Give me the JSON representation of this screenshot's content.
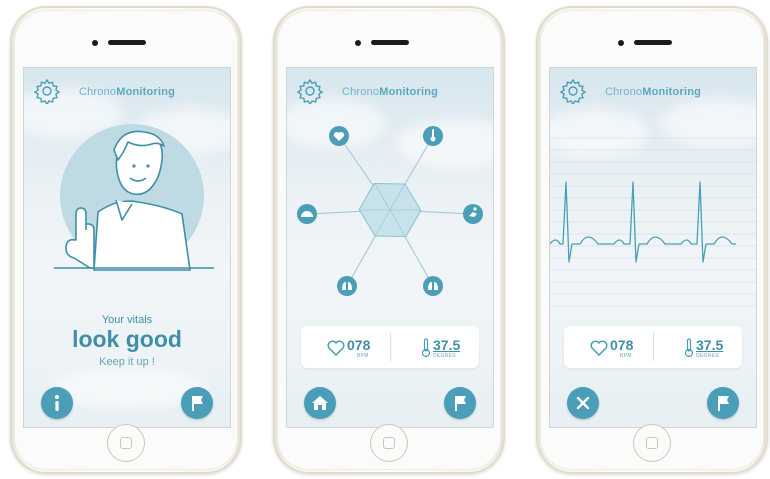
{
  "app": {
    "title_prefix": "Chrono",
    "title_suffix": "Monitoring"
  },
  "screens": [
    {
      "id": "status",
      "message_line1": "Your vitals",
      "message_line2": "look good",
      "message_line3": "Keep it up !",
      "left_button_icon": "info-icon",
      "right_button_icon": "flag-icon"
    },
    {
      "id": "hexagon",
      "heart_rate": "078",
      "heart_unit": "BPM",
      "temperature": "37.5",
      "temperature_unit": "DEGRES",
      "left_button_icon": "home-icon",
      "right_button_icon": "flag-icon",
      "nodes": [
        "heart-icon",
        "thermometer-icon",
        "runner-icon",
        "lungs-icon",
        "lungs-icon",
        "pressure-icon"
      ]
    },
    {
      "id": "ecg",
      "heart_rate": "078",
      "heart_unit": "BPM",
      "temperature": "37.5",
      "temperature_unit": "DEGRES",
      "left_button_icon": "close-icon",
      "right_button_icon": "flag-icon"
    }
  ],
  "colors": {
    "accent": "#4a9eb7",
    "text": "#3f8fa9",
    "light": "#6fb3c8"
  }
}
